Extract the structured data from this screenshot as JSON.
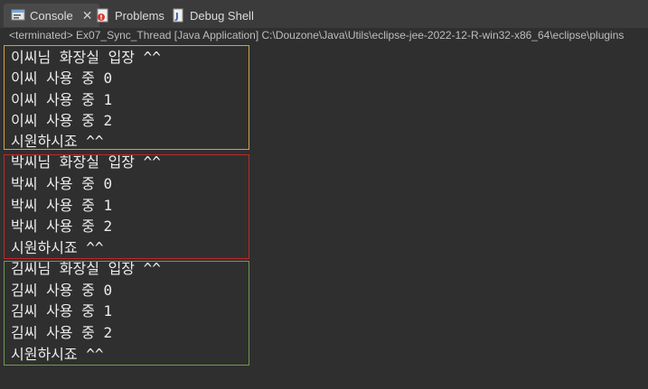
{
  "tabs": [
    {
      "label": "Console",
      "icon": "console-icon",
      "active": true
    },
    {
      "label": "Problems",
      "icon": "problems-icon",
      "active": false
    },
    {
      "label": "Debug Shell",
      "icon": "debug-shell-icon",
      "active": false
    }
  ],
  "status_text": "<terminated> Ex07_Sync_Thread [Java Application] C:\\Douzone\\Java\\Utils\\eclipse-jee-2022-12-R-win32-x86_64\\eclipse\\plugins",
  "console": {
    "groups": [
      {
        "color": "#d4a23a",
        "lines": [
          "이씨님 화장실 입장 ^^",
          "이씨 사용 중 0",
          "이씨 사용 중 1",
          "이씨 사용 중 2",
          "시원하시죠 ^^"
        ]
      },
      {
        "color": "#c0282b",
        "lines": [
          "박씨님 화장실 입장 ^^",
          "박씨 사용 중 0",
          "박씨 사용 중 1",
          "박씨 사용 중 2",
          "시원하시죠 ^^"
        ]
      },
      {
        "color": "#6f9a4c",
        "lines": [
          "김씨님 화장실 입장 ^^",
          "김씨 사용 중 0",
          "김씨 사용 중 1",
          "김씨 사용 중 2",
          "시원하시죠 ^^"
        ]
      }
    ]
  }
}
